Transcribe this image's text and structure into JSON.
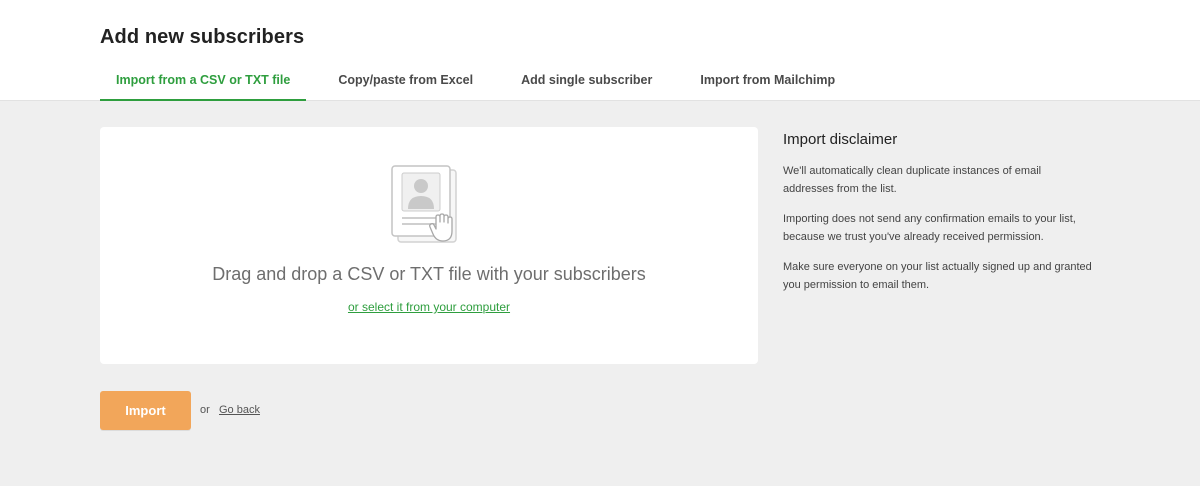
{
  "header": {
    "title": "Add new subscribers",
    "tabs": [
      {
        "label": "Import from a CSV or TXT file",
        "active": true
      },
      {
        "label": "Copy/paste from Excel",
        "active": false
      },
      {
        "label": "Add single subscriber",
        "active": false
      },
      {
        "label": "Import from Mailchimp",
        "active": false
      }
    ]
  },
  "dropzone": {
    "icon": "contact-file-hand-icon",
    "text": "Drag and drop a CSV or TXT file with your subscribers",
    "link": "or select it from your computer"
  },
  "disclaimer": {
    "title": "Import disclaimer",
    "paragraphs": [
      "We'll automatically clean duplicate instances of email addresses from the list.",
      "Importing does not send any confirmation emails to your list, because we trust you've already received permission.",
      "Make sure everyone on your list actually signed up and granted you permission to email them."
    ]
  },
  "actions": {
    "import_label": "Import",
    "or_label": "or",
    "go_back_label": "Go back"
  },
  "colors": {
    "accent_green": "#2e9e3e",
    "import_orange": "#f2a65a",
    "background": "#efefef"
  }
}
